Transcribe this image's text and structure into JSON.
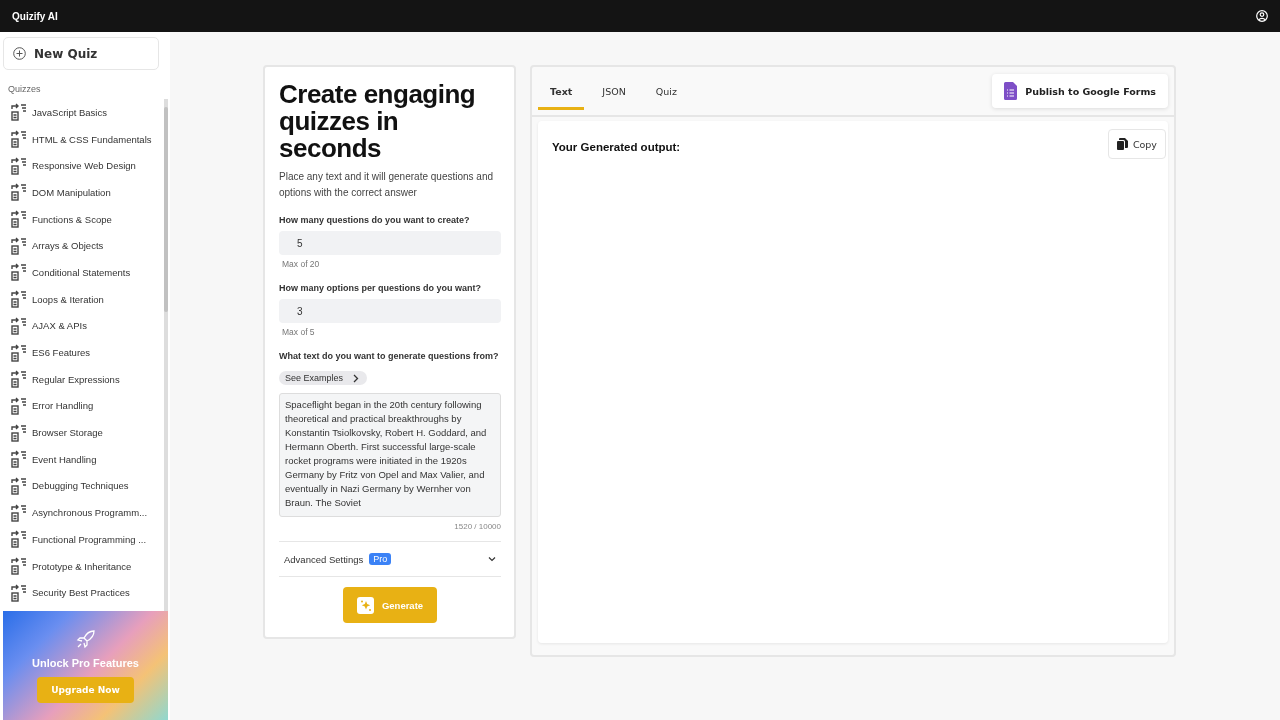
{
  "header": {
    "title": "Quizify AI"
  },
  "sidebar": {
    "new_button": "New Quiz",
    "section_label": "Quizzes",
    "items": [
      "JavaScript Basics",
      "HTML & CSS Fundamentals",
      "Responsive Web Design",
      "DOM Manipulation",
      "Functions & Scope",
      "Arrays & Objects",
      "Conditional Statements",
      "Loops & Iteration",
      "AJAX & APIs",
      "ES6 Features",
      "Regular Expressions",
      "Error Handling",
      "Browser Storage",
      "Event Handling",
      "Debugging Techniques",
      "Asynchronous Programm...",
      "Functional Programming ...",
      "Prototype & Inheritance",
      "Security Best Practices"
    ],
    "promo": {
      "title": "Unlock Pro Features",
      "button": "Upgrade Now"
    }
  },
  "form": {
    "heading": "Create engaging quizzes in seconds",
    "subtitle": "Place any text and it will generate questions and options with the correct answer",
    "fields": [
      {
        "label": "How many questions do you want to create?",
        "value": "5",
        "hint": "Max of 20"
      },
      {
        "label": "How many options per questions do you want?",
        "value": "3",
        "hint": "Max of 5"
      }
    ],
    "text_label": "What text do you want to generate questions from?",
    "examples_button": "See Examples",
    "text_value": "Spaceflight began in the 20th century following theoretical and practical breakthroughs by Konstantin Tsiolkovsky, Robert H. Goddard, and Hermann Oberth. First successful large-scale rocket programs were initiated in the 1920s Germany by Fritz von Opel and Max Valier, and eventually in Nazi Germany by Wernher von Braun. The Soviet",
    "char_count": "1520 / 10000",
    "advanced": {
      "label": "Advanced Settings",
      "badge": "Pro",
      "expanded": false
    },
    "generate_button": "Generate"
  },
  "output": {
    "tabs": [
      {
        "label": "Text",
        "selected": true
      },
      {
        "label": "JSON",
        "selected": false
      },
      {
        "label": "Quiz",
        "selected": false
      }
    ],
    "publish_button": "Publish to Google Forms",
    "heading": "Your Generated output:",
    "copy_button": "Copy"
  }
}
